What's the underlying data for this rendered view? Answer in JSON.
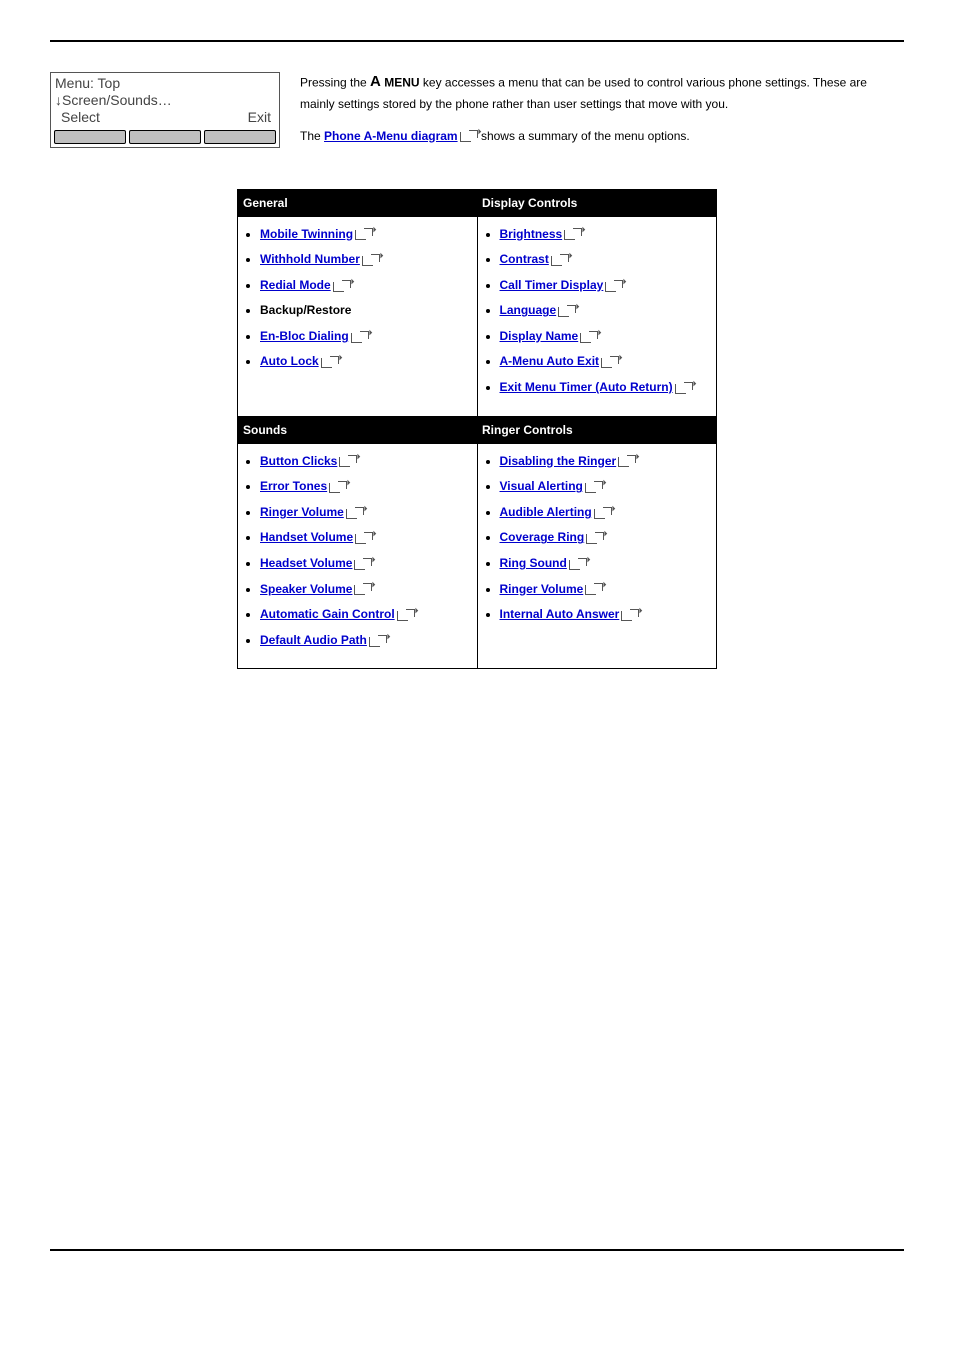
{
  "phone": {
    "line1": "Menu: Top",
    "line2": "↓Screen/Sounds…",
    "line3_left": "Select",
    "line3_right": "Exit"
  },
  "intro": {
    "p1a": "Pressing the ",
    "p1_menu": "MENU",
    "p1b": " key accesses a menu that can be used to control various phone settings. These are mainly settings stored by the phone rather than user settings that move with you.",
    "p2a": "The ",
    "p2_link": "Phone A-Menu diagram",
    "p2b": " shows a summary of the menu options."
  },
  "table": {
    "h_general": "General",
    "h_display": "Display Controls",
    "h_sounds": "Sounds",
    "h_ringer": "Ringer Controls",
    "general": [
      {
        "label": "Mobile Twinning",
        "link": true
      },
      {
        "label": "Withhold Number",
        "link": true
      },
      {
        "label": "Redial Mode",
        "link": true
      },
      {
        "label": "Backup/Restore",
        "link": false
      },
      {
        "label": "En-Bloc Dialing",
        "link": true
      },
      {
        "label": "Auto Lock",
        "link": true
      }
    ],
    "display": [
      {
        "label": "Brightness",
        "link": true
      },
      {
        "label": "Contrast",
        "link": true
      },
      {
        "label": "Call Timer Display",
        "link": true
      },
      {
        "label": "Language",
        "link": true
      },
      {
        "label": "Display Name",
        "link": true
      },
      {
        "label": "A-Menu Auto Exit",
        "link": true
      },
      {
        "label": "Exit Menu Timer (Auto Return)",
        "link": true
      }
    ],
    "sounds": [
      {
        "label": "Button Clicks",
        "link": true
      },
      {
        "label": "Error Tones",
        "link": true
      },
      {
        "label": "Ringer Volume",
        "link": true
      },
      {
        "label": "Handset Volume",
        "link": true
      },
      {
        "label": "Headset Volume",
        "link": true
      },
      {
        "label": "Speaker Volume",
        "link": true
      },
      {
        "label": "Automatic Gain Control",
        "link": true
      },
      {
        "label": "Default Audio Path",
        "link": true
      }
    ],
    "ringer": [
      {
        "label": "Disabling the Ringer",
        "link": true
      },
      {
        "label": "Visual Alerting",
        "link": true
      },
      {
        "label": "Audible Alerting",
        "link": true
      },
      {
        "label": "Coverage Ring",
        "link": true
      },
      {
        "label": "Ring Sound",
        "link": true
      },
      {
        "label": "Ringer Volume",
        "link": true
      },
      {
        "label": "Internal Auto Answer",
        "link": true
      }
    ]
  }
}
